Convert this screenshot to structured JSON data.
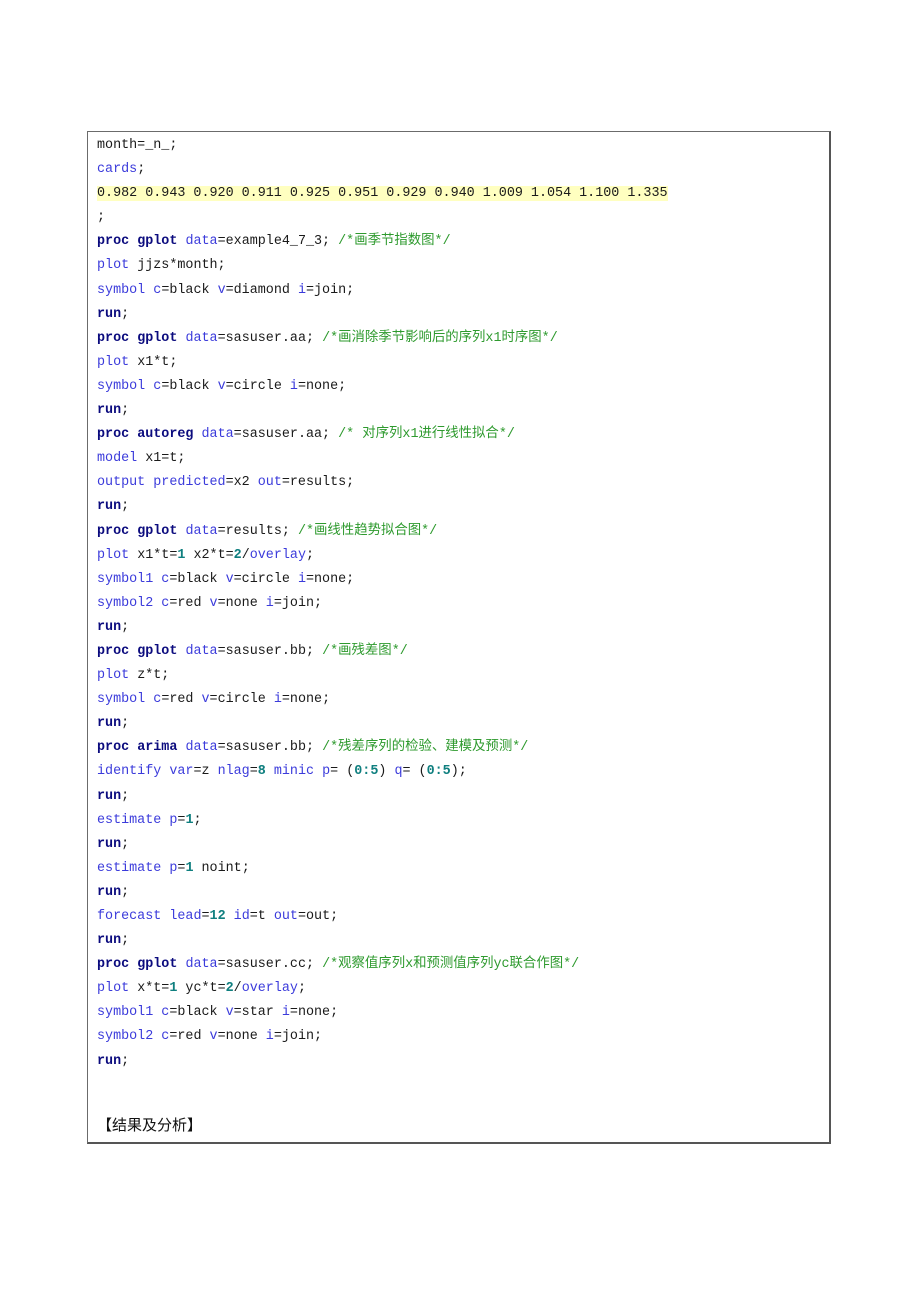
{
  "code": {
    "l1": {
      "a": "month=_n_;"
    },
    "l2": {
      "kw": "cards",
      "a": ";"
    },
    "l3": {
      "data": "0.982 0.943 0.920 0.911 0.925 0.951 0.929 0.940 1.009 1.054 1.100 1.335"
    },
    "l4": {
      "a": ";"
    },
    "l5": {
      "kw1": "proc",
      "kw2": "gplot",
      "opt": "data",
      "a": "=example4_7_3; ",
      "cm": "/*画季节指数图*/"
    },
    "l6": {
      "opt": "plot",
      "a": " jjzs*month;"
    },
    "l7": {
      "opt1": "symbol",
      "opt2": "c",
      "a": "=black ",
      "opt3": "v",
      "b": "=diamond ",
      "opt4": "i",
      "c": "=join;"
    },
    "l8": {
      "kw": "run",
      "a": ";"
    },
    "l9": {
      "kw1": "proc",
      "kw2": "gplot",
      "opt": "data",
      "a": "=sasuser.aa; ",
      "cm": "/*画消除季节影响后的序列x1时序图*/"
    },
    "l10": {
      "opt": "plot",
      "a": " x1*t;"
    },
    "l11": {
      "opt1": "symbol",
      "opt2": "c",
      "a": "=black ",
      "opt3": "v",
      "b": "=circle ",
      "opt4": "i",
      "c": "=none;"
    },
    "l12": {
      "kw": "run",
      "a": ";"
    },
    "l13": {
      "kw1": "proc",
      "kw2": "autoreg",
      "opt": "data",
      "a": "=sasuser.aa; ",
      "cm": "/* 对序列x1进行线性拟合*/"
    },
    "l14": {
      "opt": "model",
      "a": " x1=t;"
    },
    "l15": {
      "opt1": "output",
      "opt2": "predicted",
      "a": "=x2 ",
      "opt3": "out",
      "b": "=results;"
    },
    "l16": {
      "kw": "run",
      "a": ";"
    },
    "l17": {
      "kw1": "proc",
      "kw2": "gplot",
      "opt": "data",
      "a": "=results; ",
      "cm": "/*画线性趋势拟合图*/"
    },
    "l18": {
      "opt": "plot",
      "a": " x1*t=",
      "n1": "1",
      "b": " x2*t=",
      "n2": "2",
      "c": "/",
      "opt2": "overlay",
      "d": ";"
    },
    "l19": {
      "opt1": "symbol1",
      "opt2": "c",
      "a": "=black ",
      "opt3": "v",
      "b": "=circle ",
      "opt4": "i",
      "c": "=none;"
    },
    "l20": {
      "opt1": "symbol2",
      "opt2": "c",
      "a": "=red ",
      "opt3": "v",
      "b": "=none ",
      "opt4": "i",
      "c": "=join;"
    },
    "l21": {
      "kw": "run",
      "a": ";"
    },
    "l22": {
      "kw1": "proc",
      "kw2": "gplot",
      "opt": "data",
      "a": "=sasuser.bb; ",
      "cm": "/*画残差图*/"
    },
    "l23": {
      "opt": "plot",
      "a": " z*t;"
    },
    "l24": {
      "opt1": "symbol",
      "opt2": "c",
      "a": "=red ",
      "opt3": "v",
      "b": "=circle ",
      "opt4": "i",
      "c": "=none;"
    },
    "l25": {
      "kw": "run",
      "a": ";"
    },
    "l26": {
      "kw1": "proc",
      "kw2": "arima",
      "opt": "data",
      "a": "=sasuser.bb; ",
      "cm": "/*残差序列的检验、建模及预测*/"
    },
    "l27": {
      "opt1": "identify",
      "opt2": "var",
      "a": "=z ",
      "opt3": "nlag",
      "b": "=",
      "n1": "8",
      "c": " ",
      "opt4": "minic",
      "d": " ",
      "opt5": "p",
      "e": "= (",
      "n2": "0:5",
      "f": ") ",
      "opt6": "q",
      "g": "= (",
      "n3": "0:5",
      "h": ");"
    },
    "l28": {
      "kw": "run",
      "a": ";"
    },
    "l29": {
      "opt1": "estimate",
      "opt2": "p",
      "a": "=",
      "n1": "1",
      "b": ";"
    },
    "l30": {
      "kw": "run",
      "a": ";"
    },
    "l31": {
      "opt1": "estimate",
      "opt2": "p",
      "a": "=",
      "n1": "1",
      "b": " noint;"
    },
    "l32": {
      "kw": "run",
      "a": ";"
    },
    "l33": {
      "opt1": "forecast",
      "opt2": "lead",
      "a": "=",
      "n1": "12",
      "b": " ",
      "opt3": "id",
      "c": "=t ",
      "opt4": "out",
      "d": "=out;"
    },
    "l34": {
      "kw": "run",
      "a": ";"
    },
    "l35": {
      "kw1": "proc",
      "kw2": "gplot",
      "opt": "data",
      "a": "=sasuser.cc; ",
      "cm": "/*观察值序列x和预测值序列yc联合作图*/"
    },
    "l36": {
      "opt": "plot",
      "a": " x*t=",
      "n1": "1",
      "b": " yc*t=",
      "n2": "2",
      "c": "/",
      "opt2": "overlay",
      "d": ";"
    },
    "l37": {
      "opt1": "symbol1",
      "opt2": "c",
      "a": "=black ",
      "opt3": "v",
      "b": "=star ",
      "opt4": "i",
      "c": "=none;"
    },
    "l38": {
      "opt1": "symbol2",
      "opt2": "c",
      "a": "=red ",
      "opt3": "v",
      "b": "=none ",
      "opt4": "i",
      "c": "=join;"
    },
    "l39": {
      "kw": "run",
      "a": ";"
    }
  },
  "result_heading": "【结果及分析】"
}
